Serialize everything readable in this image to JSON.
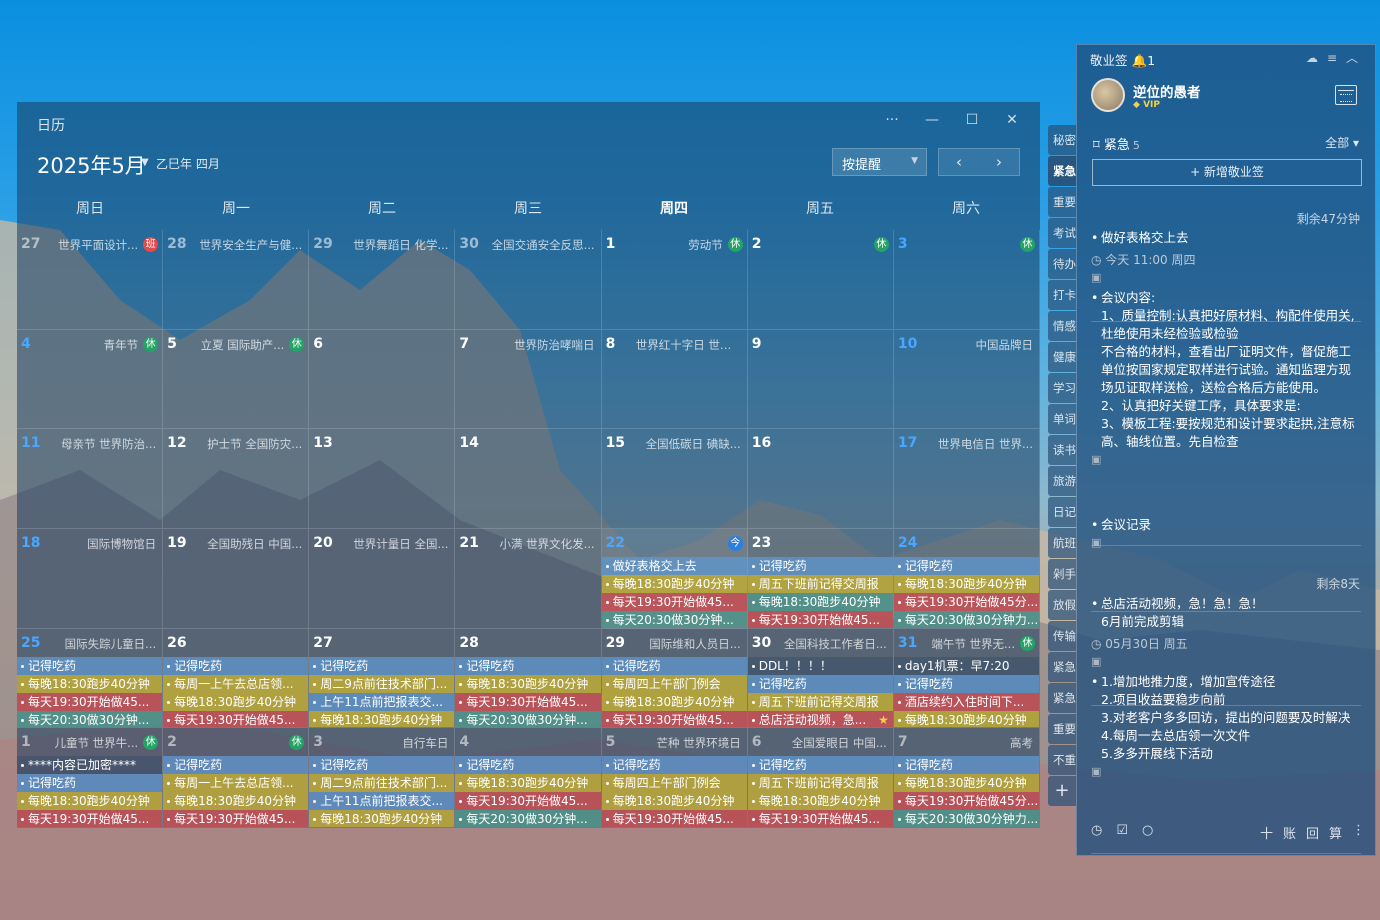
{
  "calendar": {
    "title": "日历",
    "month_label": "2025年5月",
    "lunar": "乙巳年 四月",
    "sort_label": "按提醒",
    "prev": "‹",
    "next": "›",
    "window_buttons": [
      "···",
      "—",
      "☐",
      "✕"
    ],
    "weekdays": [
      "周日",
      "周一",
      "周二",
      "周三",
      "周四",
      "周五",
      "周六"
    ],
    "cells": [
      {
        "d": "27",
        "dim": true,
        "fest": "世界平面设计...",
        "badge": "班",
        "bc": "r"
      },
      {
        "d": "28",
        "dim": true,
        "fest": "世界安全生产与健..."
      },
      {
        "d": "29",
        "dim": true,
        "fest": "世界舞蹈日 化学..."
      },
      {
        "d": "30",
        "dim": true,
        "fest": "全国交通安全反思..."
      },
      {
        "d": "1",
        "fest": "劳动节",
        "badge": "休",
        "bc": "g"
      },
      {
        "d": "2",
        "badge": "休",
        "bc": "g"
      },
      {
        "d": "3",
        "blue": true,
        "badge": "休",
        "bc": "g"
      },
      {
        "d": "4",
        "blue": true,
        "fest": "青年节",
        "badge": "休",
        "bc": "g"
      },
      {
        "d": "5",
        "fest": "立夏 国际助产...",
        "badge": "休",
        "bc": "g"
      },
      {
        "d": "6"
      },
      {
        "d": "7",
        "fest": "世界防治哮喘日"
      },
      {
        "d": "8",
        "fest": "世界红十字日 世界..."
      },
      {
        "d": "9"
      },
      {
        "d": "10",
        "blue": true,
        "fest": "中国品牌日"
      },
      {
        "d": "11",
        "blue": true,
        "fest": "母亲节 世界防治..."
      },
      {
        "d": "12",
        "fest": "护士节 全国防灾..."
      },
      {
        "d": "13"
      },
      {
        "d": "14"
      },
      {
        "d": "15",
        "fest": "全国低碳日 碘缺..."
      },
      {
        "d": "16"
      },
      {
        "d": "17",
        "blue": true,
        "fest": "世界电信日 世界..."
      },
      {
        "d": "18",
        "blue": true,
        "fest": "国际博物馆日"
      },
      {
        "d": "19",
        "fest": "全国助残日 中国..."
      },
      {
        "d": "20",
        "fest": "世界计量日 全国..."
      },
      {
        "d": "21",
        "fest": "小满 世界文化发..."
      },
      {
        "d": "22",
        "blue": true,
        "today": true,
        "badge": "今",
        "bc": "b",
        "events": [
          [
            "做好表格交上去",
            "blue"
          ],
          [
            "每晚18:30跑步40分钟",
            "yel"
          ],
          [
            "每天19:30开始做45...",
            "red"
          ],
          [
            "每天20:30做30分钟...",
            "teal"
          ]
        ]
      },
      {
        "d": "23",
        "events": [
          [
            "记得吃药",
            "blue"
          ],
          [
            "周五下班前记得交周报",
            "yel"
          ],
          [
            "每晚18:30跑步40分钟",
            "teal"
          ],
          [
            "每天19:30开始做45...",
            "red"
          ]
        ]
      },
      {
        "d": "24",
        "blue": true,
        "events": [
          [
            "记得吃药",
            "blue"
          ],
          [
            "每晚18:30跑步40分钟",
            "yel"
          ],
          [
            "每天19:30开始做45分...",
            "red"
          ],
          [
            "每天20:30做30分钟力...",
            "teal"
          ]
        ]
      },
      {
        "d": "25",
        "blue": true,
        "fest": "国际失踪儿童日...",
        "events": [
          [
            "记得吃药",
            "blue"
          ],
          [
            "每晚18:30跑步40分钟",
            "yel"
          ],
          [
            "每天19:30开始做45...",
            "red"
          ],
          [
            "每天20:30做30分钟...",
            "teal"
          ]
        ]
      },
      {
        "d": "26",
        "events": [
          [
            "记得吃药",
            "blue"
          ],
          [
            "每周一上午去总店领...",
            "yel"
          ],
          [
            "每晚18:30跑步40分钟",
            "yel"
          ],
          [
            "每天19:30开始做45...",
            "red"
          ]
        ]
      },
      {
        "d": "27",
        "events": [
          [
            "记得吃药",
            "blue"
          ],
          [
            "周二9点前往技术部门...",
            "yel"
          ],
          [
            "上午11点前把报表交...",
            "blue"
          ],
          [
            "每晚18:30跑步40分钟",
            "yel"
          ]
        ]
      },
      {
        "d": "28",
        "events": [
          [
            "记得吃药",
            "blue"
          ],
          [
            "每晚18:30跑步40分钟",
            "yel"
          ],
          [
            "每天19:30开始做45...",
            "red"
          ],
          [
            "每天20:30做30分钟...",
            "teal"
          ]
        ]
      },
      {
        "d": "29",
        "fest": "国际维和人员日...",
        "events": [
          [
            "记得吃药",
            "blue"
          ],
          [
            "每周四上午部门例会",
            "yel"
          ],
          [
            "每晚18:30跑步40分钟",
            "yel"
          ],
          [
            "每天19:30开始做45...",
            "red"
          ]
        ]
      },
      {
        "d": "30",
        "fest": "全国科技工作者日...",
        "events": [
          [
            "DDL！！！！",
            "plain"
          ],
          [
            "记得吃药",
            "blue"
          ],
          [
            "周五下班前记得交周报",
            "yel"
          ],
          [
            "总店活动视频，急...",
            "red",
            "star"
          ]
        ]
      },
      {
        "d": "31",
        "blue": true,
        "fest": "端午节 世界无...",
        "badge": "休",
        "bc": "g",
        "events": [
          [
            "day1机票：早7:20",
            "plain"
          ],
          [
            "记得吃药",
            "blue"
          ],
          [
            "酒店续约入住时间下...",
            "red"
          ],
          [
            "每晚18:30跑步40分钟",
            "yel"
          ]
        ]
      },
      {
        "d": "1",
        "dim": true,
        "fest": "儿童节 世界牛...",
        "badge": "休",
        "bc": "g",
        "events": [
          [
            "****内容已加密****",
            "plain"
          ],
          [
            "记得吃药",
            "blue"
          ],
          [
            "每晚18:30跑步40分钟",
            "yel"
          ],
          [
            "每天19:30开始做45...",
            "red"
          ]
        ]
      },
      {
        "d": "2",
        "dim": true,
        "badge": "休",
        "bc": "g",
        "events": [
          [
            "记得吃药",
            "blue"
          ],
          [
            "每周一上午去总店领...",
            "yel"
          ],
          [
            "每晚18:30跑步40分钟",
            "yel"
          ],
          [
            "每天19:30开始做45...",
            "red"
          ]
        ]
      },
      {
        "d": "3",
        "dim": true,
        "fest": "自行车日",
        "events": [
          [
            "记得吃药",
            "blue"
          ],
          [
            "周二9点前往技术部门...",
            "yel"
          ],
          [
            "上午11点前把报表交...",
            "blue"
          ],
          [
            "每晚18:30跑步40分钟",
            "yel"
          ]
        ]
      },
      {
        "d": "4",
        "dim": true,
        "events": [
          [
            "记得吃药",
            "blue"
          ],
          [
            "每晚18:30跑步40分钟",
            "yel"
          ],
          [
            "每天19:30开始做45...",
            "red"
          ],
          [
            "每天20:30做30分钟...",
            "teal"
          ]
        ]
      },
      {
        "d": "5",
        "dim": true,
        "fest": "芒种 世界环境日",
        "events": [
          [
            "记得吃药",
            "blue"
          ],
          [
            "每周四上午部门例会",
            "yel"
          ],
          [
            "每晚18:30跑步40分钟",
            "yel"
          ],
          [
            "每天19:30开始做45...",
            "red"
          ]
        ]
      },
      {
        "d": "6",
        "dim": true,
        "fest": "全国爱眼日 中国...",
        "events": [
          [
            "记得吃药",
            "blue"
          ],
          [
            "周五下班前记得交周报",
            "yel"
          ],
          [
            "每晚18:30跑步40分钟",
            "yel"
          ],
          [
            "每天19:30开始做45...",
            "red"
          ]
        ]
      },
      {
        "d": "7",
        "dim": true,
        "fest": "高考",
        "events": [
          [
            "记得吃药",
            "blue"
          ],
          [
            "每晚18:30跑步40分钟",
            "yel"
          ],
          [
            "每天19:30开始做45分...",
            "red"
          ],
          [
            "每天20:30做30分钟力...",
            "teal"
          ]
        ]
      }
    ]
  },
  "tabs": [
    "秘密",
    "紧急",
    "重要",
    "考试",
    "待办",
    "打卡",
    "情感",
    "健康",
    "学习",
    "单词",
    "读书",
    "旅游",
    "日记",
    "航班",
    "剁手",
    "放假",
    "传输",
    "紧急",
    "紧急",
    "重要",
    "不重"
  ],
  "tab_plus": "+",
  "panel": {
    "app_name": "敬业签",
    "bell_count": "1",
    "header_icons": "☁≡︿",
    "user": "逆位的愚者",
    "vip": "VIP",
    "category": "紧急",
    "category_count": "5",
    "filter": "全部",
    "filter_caret": "▾",
    "new_button": "+ 新增敬业签",
    "notes": [
      {
        "remain": "剩余47分钟",
        "text": "做好表格交上去",
        "meta": "今天 11:00 周四"
      },
      {
        "text": "会议内容:\n1、质量控制:认真把好原材料、构配件使用关,杜绝使用未经检验或检验\n不合格的材料，查看出厂证明文件，督促施工单位按国家规定取样进行试验。通知监理方现场见证取样送检，送检合格后方能使用。\n2、认真把好关键工序，具体要求是:\n3、模板工程:要按规范和设计要求起拱,注意标高、轴线位置。先自检查"
      },
      {
        "text": "会议记录"
      },
      {
        "remain": "剩余8天",
        "text": "总店活动视频，急！急！急！\n6月前完成剪辑",
        "meta": "05月30日 周五"
      },
      {
        "text": "1.增加地推力度，增加宣传途径\n2.项目收益要稳步向前\n3.对老客户多多回访，提出的问题要及时解决\n4.每周一去总店领一次文件\n5.多多开展线下活动"
      }
    ],
    "footer_left": [
      "◷",
      "☑",
      "○"
    ],
    "footer_right": [
      "十",
      "账",
      "回",
      "算",
      "⋮"
    ]
  }
}
